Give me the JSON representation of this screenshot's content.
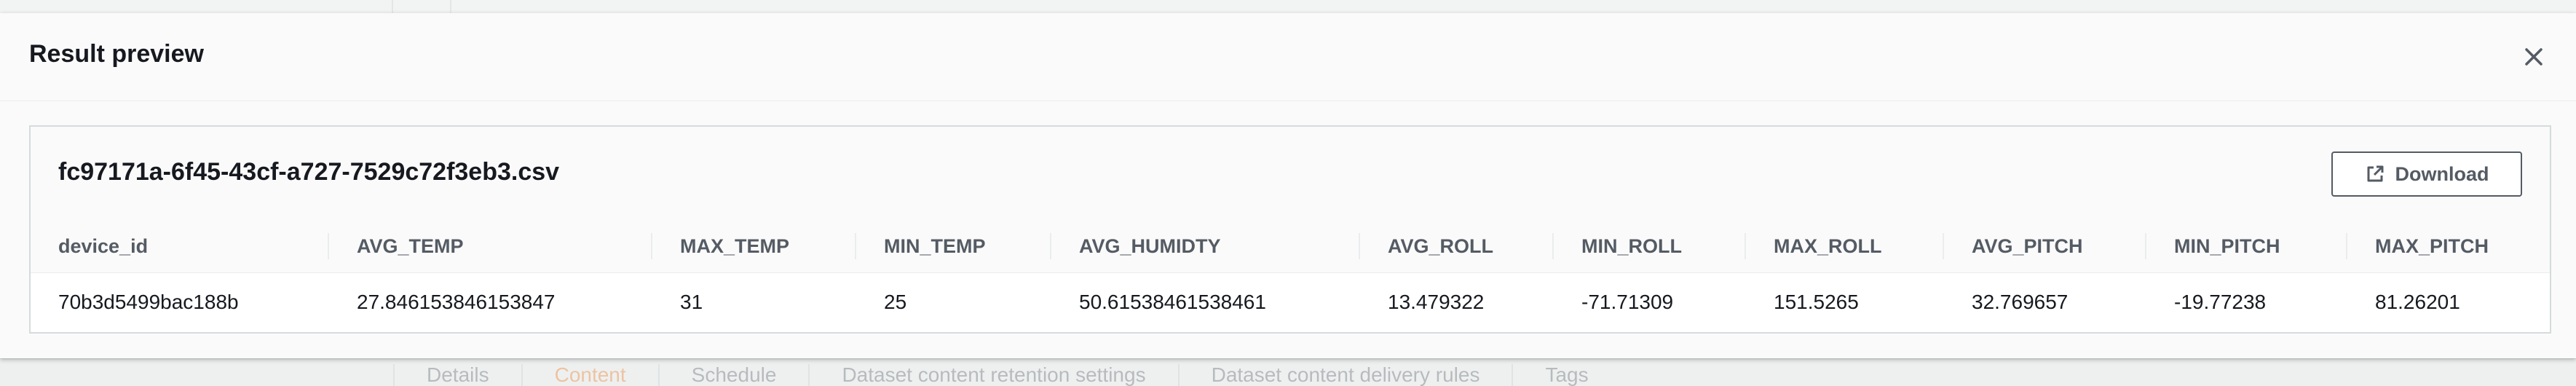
{
  "modal": {
    "title": "Result preview"
  },
  "file": {
    "name": "fc97171a-6f45-43cf-a727-7529c72f3eb3.csv",
    "download_label": "Download"
  },
  "table": {
    "columns": [
      "device_id",
      "AVG_TEMP",
      "MAX_TEMP",
      "MIN_TEMP",
      "AVG_HUMIDTY",
      "AVG_ROLL",
      "MIN_ROLL",
      "MAX_ROLL",
      "AVG_PITCH",
      "MIN_PITCH",
      "MAX_PITCH"
    ],
    "rows": [
      [
        "70b3d5499bac188b",
        "27.846153846153847",
        "31",
        "25",
        "50.61538461538461",
        "13.479322",
        "-71.71309",
        "151.5265",
        "32.769657",
        "-19.77238",
        "81.26201"
      ]
    ]
  },
  "background_tabs": [
    "Details",
    "Content",
    "Schedule",
    "Dataset content retention settings",
    "Dataset content delivery rules",
    "Tags"
  ],
  "colors": {
    "active_tab": "#ec7211",
    "text": "#16191f",
    "muted": "#545b64"
  },
  "icons": {
    "close": "close-icon",
    "download": "external-link-icon"
  }
}
